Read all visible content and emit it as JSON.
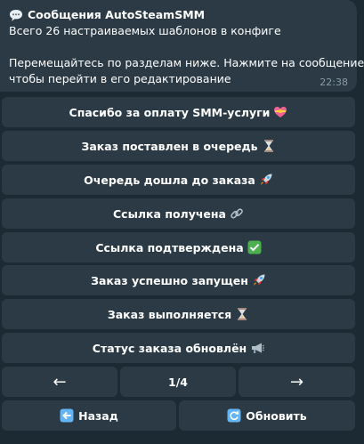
{
  "message": {
    "title": "Сообщения AutoSteamSMM",
    "line1": "Всего 26 настраиваемых шаблонов в конфиге",
    "line2": "Перемещайтесь по разделам ниже. Нажмите на сообщение,",
    "line3": "чтобы перейти в его редактирование",
    "time": "22:38"
  },
  "buttons": [
    {
      "label": "Спасибо за оплату SMM-услуги",
      "icon": "heart-ribbon-icon"
    },
    {
      "label": "Заказ поставлен в очередь",
      "icon": "hourglass-icon"
    },
    {
      "label": "Очередь дошла до заказа",
      "icon": "rocket-icon"
    },
    {
      "label": "Ссылка получена",
      "icon": "link-icon"
    },
    {
      "label": "Ссылка подтверждена",
      "icon": "check-mark-icon"
    },
    {
      "label": "Заказ успешно запущен",
      "icon": "rocket-icon"
    },
    {
      "label": "Заказ выполняется",
      "icon": "hourglass-icon"
    },
    {
      "label": "Статус заказа обновлён",
      "icon": "megaphone-icon"
    }
  ],
  "pagination": {
    "prev": "←",
    "page": "1/4",
    "next": "→"
  },
  "footer": {
    "back_label": "Назад",
    "back_icon": "back-arrow-icon",
    "refresh_label": "Обновить",
    "refresh_icon": "refresh-icon"
  }
}
